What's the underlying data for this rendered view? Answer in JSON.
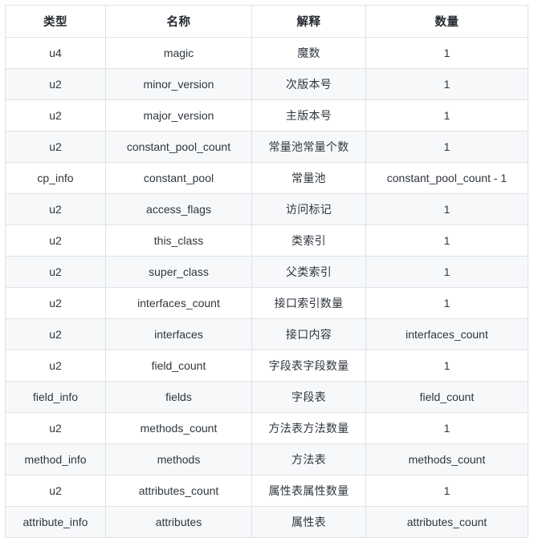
{
  "table": {
    "columns": [
      {
        "key": "type",
        "label": "类型"
      },
      {
        "key": "name",
        "label": "名称"
      },
      {
        "key": "explain",
        "label": "解释"
      },
      {
        "key": "quantity",
        "label": "数量"
      }
    ],
    "rows": [
      {
        "type": "u4",
        "name": "magic",
        "explain": "魔数",
        "quantity": "1"
      },
      {
        "type": "u2",
        "name": "minor_version",
        "explain": "次版本号",
        "quantity": "1"
      },
      {
        "type": "u2",
        "name": "major_version",
        "explain": "主版本号",
        "quantity": "1"
      },
      {
        "type": "u2",
        "name": "constant_pool_count",
        "explain": "常量池常量个数",
        "quantity": "1"
      },
      {
        "type": "cp_info",
        "name": "constant_pool",
        "explain": "常量池",
        "quantity": "constant_pool_count - 1"
      },
      {
        "type": "u2",
        "name": "access_flags",
        "explain": "访问标记",
        "quantity": "1"
      },
      {
        "type": "u2",
        "name": "this_class",
        "explain": "类索引",
        "quantity": "1"
      },
      {
        "type": "u2",
        "name": "super_class",
        "explain": "父类索引",
        "quantity": "1"
      },
      {
        "type": "u2",
        "name": "interfaces_count",
        "explain": "接口索引数量",
        "quantity": "1"
      },
      {
        "type": "u2",
        "name": "interfaces",
        "explain": "接口内容",
        "quantity": "interfaces_count"
      },
      {
        "type": "u2",
        "name": "field_count",
        "explain": "字段表字段数量",
        "quantity": "1"
      },
      {
        "type": "field_info",
        "name": "fields",
        "explain": "字段表",
        "quantity": "field_count"
      },
      {
        "type": "u2",
        "name": "methods_count",
        "explain": "方法表方法数量",
        "quantity": "1"
      },
      {
        "type": "method_info",
        "name": "methods",
        "explain": "方法表",
        "quantity": "methods_count"
      },
      {
        "type": "u2",
        "name": "attributes_count",
        "explain": "属性表属性数量",
        "quantity": "1"
      },
      {
        "type": "attribute_info",
        "name": "attributes",
        "explain": "属性表",
        "quantity": "attributes_count"
      }
    ]
  },
  "style": {
    "border_color": "#dfe2e5",
    "stripe_color": "#f6f8fa",
    "background": "#ffffff",
    "text_color": "#24292e"
  }
}
